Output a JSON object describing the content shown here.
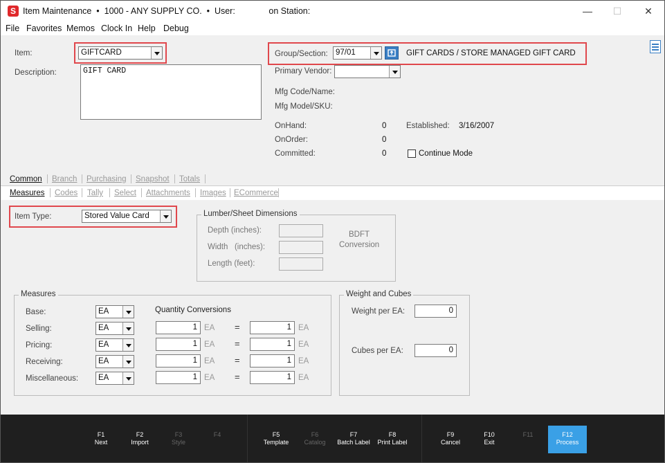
{
  "titlebar": {
    "title": "Item Maintenance  •  1000 - ANY SUPPLY CO.  •  User:              on Station:",
    "minimize": "—",
    "maximize": "☐",
    "close": "✕"
  },
  "menu": [
    "File",
    "Favorites",
    "Memos",
    "Clock In",
    "Help",
    "Debug"
  ],
  "item": {
    "item_label": "Item:",
    "item_value": "GIFTCARD",
    "desc_label": "Description:",
    "desc_value": "GIFT CARD",
    "group_label": "Group/Section:",
    "group_value": "97/01",
    "group_desc": "GIFT CARDS / STORE MANAGED GIFT CARD",
    "vendor_label": "Primary Vendor:",
    "vendor_value": "",
    "mfg_code_label": "Mfg Code/Name:",
    "mfg_model_label": "Mfg Model/SKU:",
    "onhand_label": "OnHand:",
    "onhand_value": "0",
    "onorder_label": "OnOrder:",
    "onorder_value": "0",
    "committed_label": "Committed:",
    "committed_value": "0",
    "established_label": "Established:",
    "established_value": "3/16/2007",
    "continue_mode_label": "Continue Mode"
  },
  "tabs1": [
    {
      "label": "Common",
      "active": true
    },
    {
      "label": "Branch",
      "active": false
    },
    {
      "label": "Purchasing",
      "active": false
    },
    {
      "label": "Snapshot",
      "active": false
    },
    {
      "label": "Totals",
      "active": false
    }
  ],
  "tabs2": [
    {
      "label": "Measures",
      "active": true
    },
    {
      "label": "Codes",
      "active": false
    },
    {
      "label": "Tally",
      "active": false
    },
    {
      "label": "Select",
      "active": false
    },
    {
      "label": "Attachments",
      "active": false
    },
    {
      "label": "Images",
      "active": false
    },
    {
      "label": "ECommerce",
      "active": false
    }
  ],
  "item_type": {
    "label": "Item Type:",
    "value": "Stored Value Card"
  },
  "lumber": {
    "title": "Lumber/Sheet Dimensions",
    "depth_label": "Depth (inches):",
    "width_label": "Width   (inches):",
    "length_label": "Length (feet):",
    "bdft_label": "BDFT",
    "conversion_label": "Conversion"
  },
  "measures": {
    "title": "Measures",
    "qc_label": "Quantity Conversions",
    "base_label": "Base:",
    "base_unit": "EA",
    "rows": [
      {
        "label": "Selling:",
        "unit": "EA",
        "qty1": "1",
        "u1": "EA",
        "eq": "=",
        "qty2": "1",
        "u2": "EA"
      },
      {
        "label": "Pricing:",
        "unit": "EA",
        "qty1": "1",
        "u1": "EA",
        "eq": "=",
        "qty2": "1",
        "u2": "EA"
      },
      {
        "label": "Receiving:",
        "unit": "EA",
        "qty1": "1",
        "u1": "EA",
        "eq": "=",
        "qty2": "1",
        "u2": "EA"
      },
      {
        "label": "Miscellaneous:",
        "unit": "EA",
        "qty1": "1",
        "u1": "EA",
        "eq": "=",
        "qty2": "1",
        "u2": "EA"
      }
    ]
  },
  "weight": {
    "title": "Weight and Cubes",
    "weight_label": "Weight per EA:",
    "weight_value": "0",
    "cubes_label": "Cubes per EA:",
    "cubes_value": "0"
  },
  "footer": {
    "keys": [
      {
        "k": "F1",
        "l": "Next",
        "enabled": true
      },
      {
        "k": "F2",
        "l": "Import",
        "enabled": true
      },
      {
        "k": "F3",
        "l": "Style",
        "enabled": false
      },
      {
        "k": "F4",
        "l": "",
        "enabled": false
      },
      {
        "k": "F5",
        "l": "Template",
        "enabled": true
      },
      {
        "k": "F6",
        "l": "Catalog",
        "enabled": false
      },
      {
        "k": "F7",
        "l": "Batch Label",
        "enabled": true
      },
      {
        "k": "F8",
        "l": "Print Label",
        "enabled": true
      },
      {
        "k": "F9",
        "l": "Cancel",
        "enabled": true
      },
      {
        "k": "F10",
        "l": "Exit",
        "enabled": true
      },
      {
        "k": "F11",
        "l": "",
        "enabled": false
      },
      {
        "k": "F12",
        "l": "Process",
        "enabled": true
      }
    ]
  },
  "colors": {
    "highlight": "#e0474c",
    "process_button": "#3aa0e6",
    "footer_bg": "#1f1f1f"
  }
}
